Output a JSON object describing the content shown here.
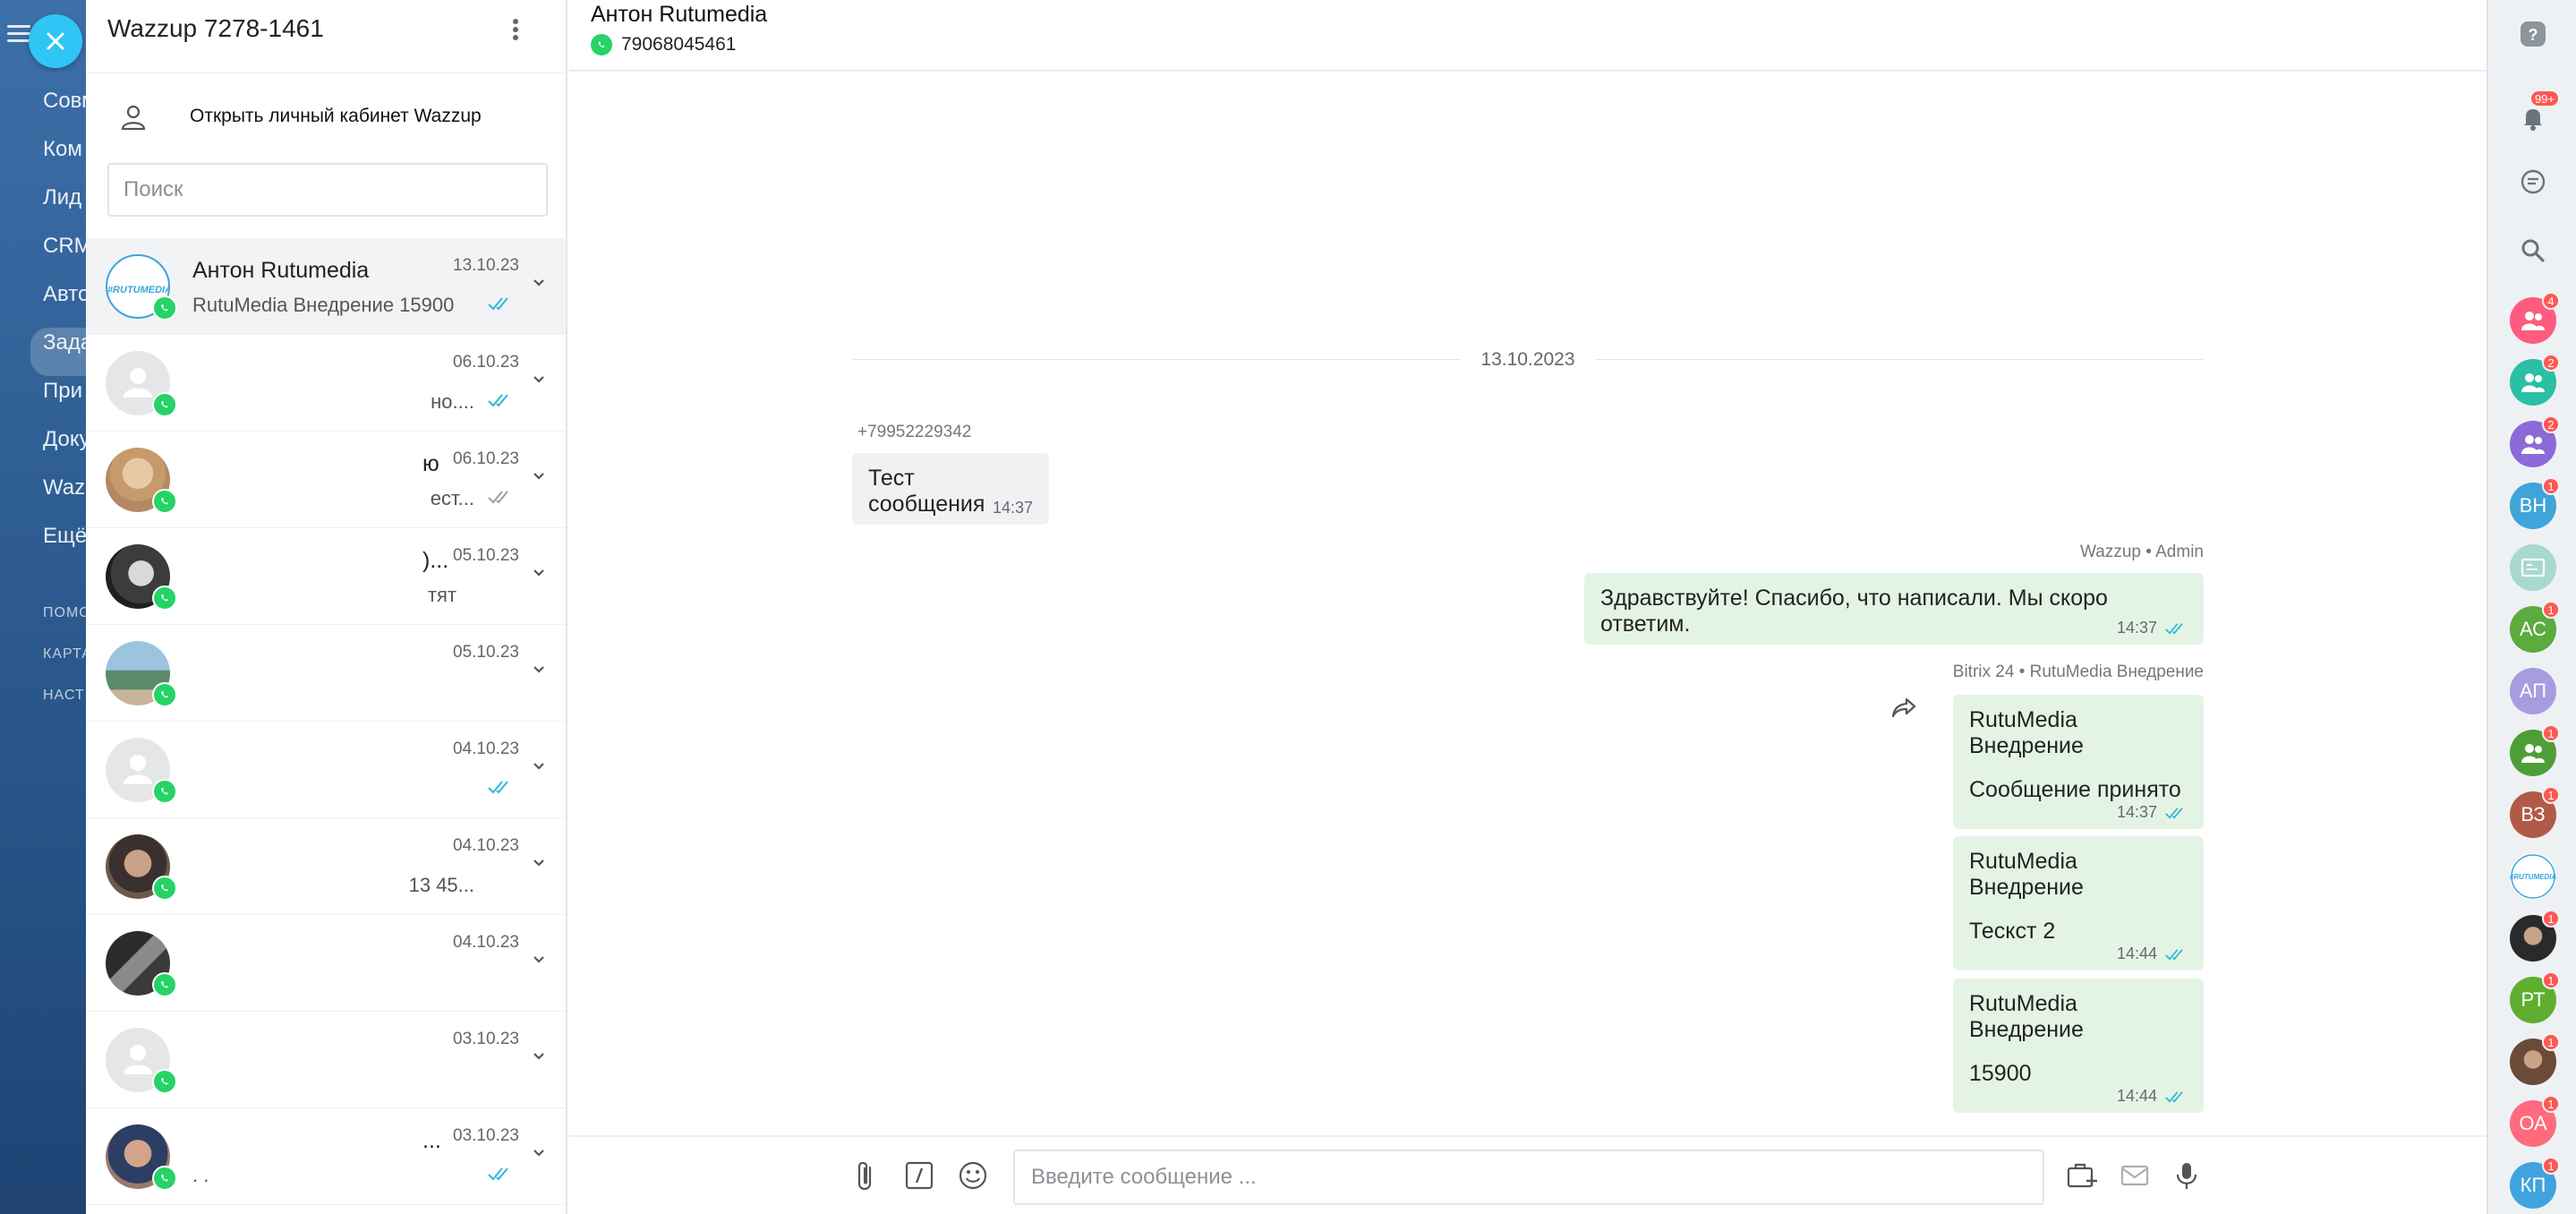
{
  "bitrix_nav": {
    "items": [
      "Совм",
      "Ком",
      "Лид",
      "CRM",
      "Авто",
      "Зада",
      "При",
      "Доку",
      "Waz",
      "Ещё"
    ],
    "small": [
      "ПОМО",
      "КАРТА",
      "НАСТ"
    ]
  },
  "chat_list": {
    "title": "Wazzup 7278-1461",
    "open_cabinet": "Открыть личный кабинет Wazzup",
    "search_placeholder": "Поиск",
    "items": [
      {
        "name": "Антон Rutumedia",
        "preview": "RutuMedia Внедрение 15900",
        "date": "13.10.23",
        "ticks": "read"
      },
      {
        "name": "",
        "preview": "но....",
        "date": "06.10.23",
        "ticks": "read"
      },
      {
        "name": "ю",
        "preview": "ест...",
        "date": "06.10.23",
        "ticks": "delivered"
      },
      {
        "name": ")...",
        "preview": "тят",
        "date": "05.10.23",
        "ticks": ""
      },
      {
        "name": "",
        "preview": "",
        "date": "05.10.23",
        "ticks": ""
      },
      {
        "name": "",
        "preview": "",
        "date": "04.10.23",
        "ticks": "read"
      },
      {
        "name": "",
        "preview": "13 45...",
        "date": "04.10.23",
        "ticks": ""
      },
      {
        "name": "",
        "preview": "",
        "date": "04.10.23",
        "ticks": ""
      },
      {
        "name": "",
        "preview": "",
        "date": "03.10.23",
        "ticks": ""
      },
      {
        "name": "...",
        "preview": ". .",
        "date": "03.10.23",
        "ticks": "read"
      }
    ]
  },
  "conversation": {
    "contact_name": "Антон Rutumedia",
    "phone": "79068045461",
    "date_divider": "13.10.2023",
    "messages": [
      {
        "sender": "+79952229342",
        "text": "Тест сообщения",
        "time": "14:37"
      },
      {
        "sender": "Wazzup • Admin",
        "text": "Здравствуйте! Спасибо, что написали. Мы скоро ответим.",
        "time": "14:37"
      },
      {
        "sender": "Bitrix 24 • RutuMedia Внедрение",
        "text": "RutuMedia Внедрение",
        "text2": "Сообщение принято",
        "time": "14:37"
      },
      {
        "text": "RutuMedia Внедрение",
        "text2": "Тескст 2",
        "time": "14:44"
      },
      {
        "text": "RutuMedia Внедрение",
        "text2": "15900",
        "time": "14:44"
      }
    ],
    "composer_placeholder": "Введите сообщение ..."
  },
  "right_bar": {
    "notifications_badge": "99+",
    "avatars": [
      {
        "label": "",
        "color": "#ff5b7f",
        "badge": "4",
        "kind": "group"
      },
      {
        "label": "",
        "color": "#2bbfa5",
        "badge": "2",
        "kind": "group"
      },
      {
        "label": "",
        "color": "#8d6ad8",
        "badge": "2",
        "kind": "group"
      },
      {
        "label": "ВН",
        "color": "#3fa4d9",
        "badge": "1"
      },
      {
        "label": "",
        "color": "#a8d8d0",
        "badge": "",
        "kind": "channel"
      },
      {
        "label": "АС",
        "color": "#5bab3e",
        "badge": "1"
      },
      {
        "label": "АП",
        "color": "#a89be0",
        "badge": ""
      },
      {
        "label": "",
        "color": "#4e9e38",
        "badge": "1",
        "kind": "group"
      },
      {
        "label": "ВЗ",
        "color": "#b05a47",
        "badge": "1"
      },
      {
        "label": "",
        "color": "#ffffff",
        "badge": "",
        "kind": "logo"
      },
      {
        "label": "",
        "color": "#2a2a2a",
        "badge": "1",
        "kind": "photo"
      },
      {
        "label": "РТ",
        "color": "#5fae2f",
        "badge": "1"
      },
      {
        "label": "",
        "color": "#6b4a3a",
        "badge": "1",
        "kind": "photo"
      },
      {
        "label": "ОА",
        "color": "#ff6a7d",
        "badge": "1"
      },
      {
        "label": "КП",
        "color": "#3fa3dd",
        "badge": "1"
      }
    ]
  },
  "colors": {
    "whatsapp": "#25d366",
    "accent": "#2fc6f6",
    "tick_read": "#2fb8d9",
    "outgoing_bubble": "#e4f4e4",
    "incoming_bubble": "#f0f1f3"
  }
}
